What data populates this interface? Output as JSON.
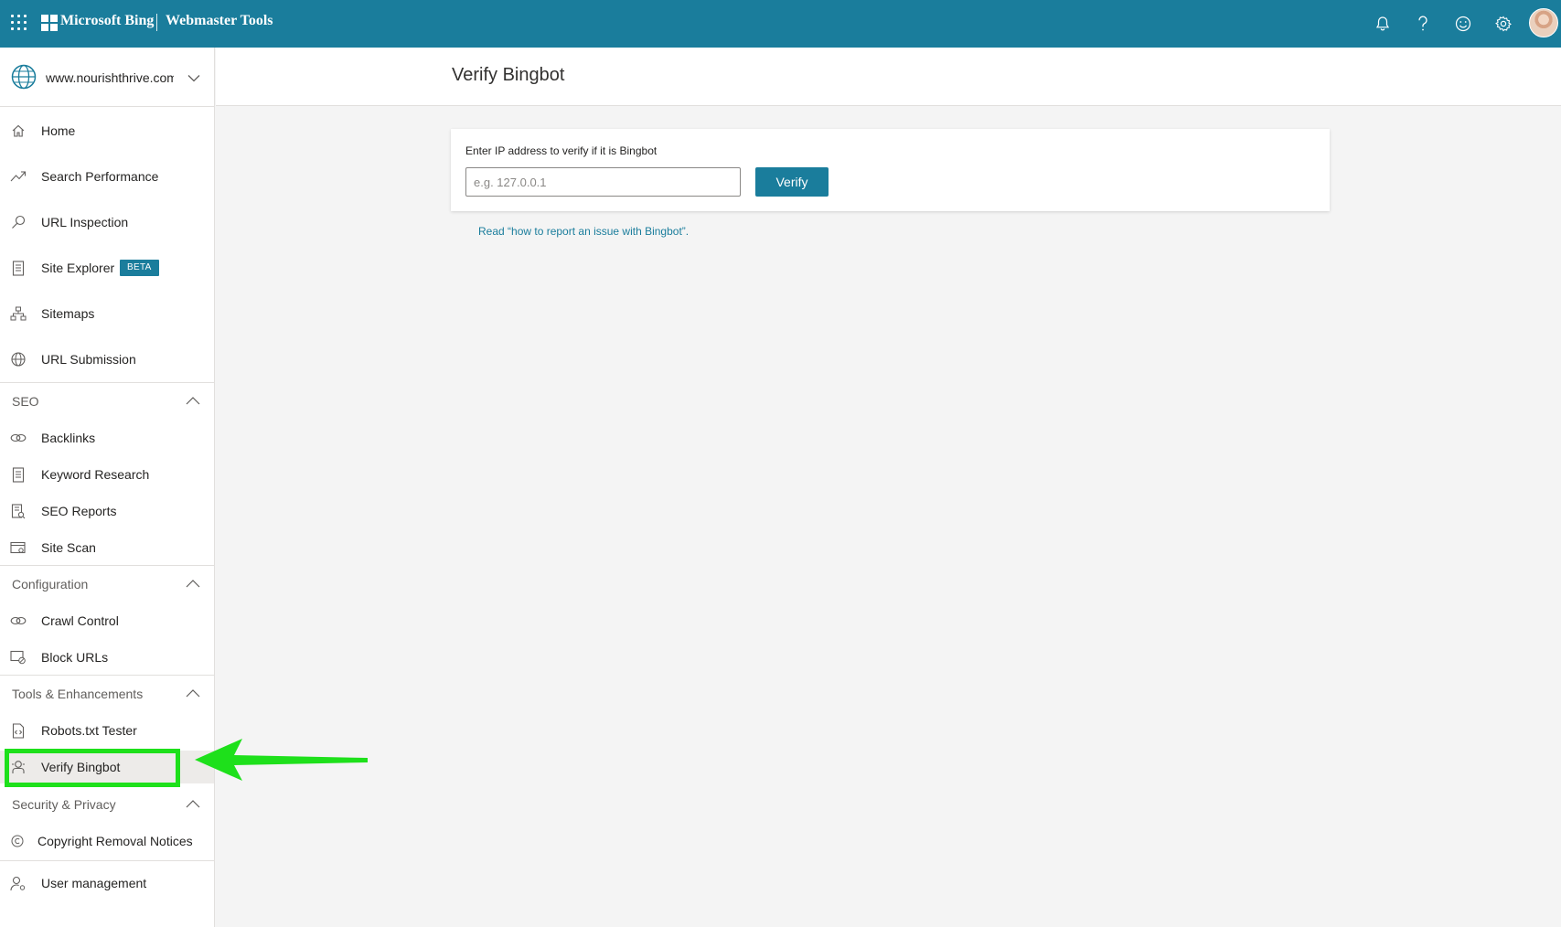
{
  "topbar": {
    "brand": "Microsoft Bing",
    "product": "Webmaster Tools",
    "icons": [
      "waffle-icon",
      "bell-icon",
      "help-icon",
      "feedback-smiley-icon",
      "gear-icon",
      "avatar"
    ],
    "bg_color": "#1a7d9c"
  },
  "sidebar": {
    "site": {
      "url": "www.nourishthrive.com",
      "icon": "globe-icon"
    },
    "items": [
      {
        "label": "Home",
        "icon": "home-icon"
      },
      {
        "label": "Search Performance",
        "icon": "trend-icon"
      },
      {
        "label": "URL Inspection",
        "icon": "search-icon"
      },
      {
        "label": "Site Explorer",
        "icon": "document-icon",
        "badge": "BETA"
      },
      {
        "label": "Sitemaps",
        "icon": "sitemap-icon"
      },
      {
        "label": "URL Submission",
        "icon": "globe-icon"
      }
    ],
    "sections": [
      {
        "title": "SEO",
        "items": [
          {
            "label": "Backlinks",
            "icon": "link-icon"
          },
          {
            "label": "Keyword Research",
            "icon": "document-icon"
          },
          {
            "label": "SEO Reports",
            "icon": "report-icon"
          },
          {
            "label": "Site Scan",
            "icon": "scan-icon"
          }
        ]
      },
      {
        "title": "Configuration",
        "items": [
          {
            "label": "Crawl Control",
            "icon": "link-icon"
          },
          {
            "label": "Block URLs",
            "icon": "block-icon"
          }
        ]
      },
      {
        "title": "Tools & Enhancements",
        "items": [
          {
            "label": "Robots.txt Tester",
            "icon": "code-file-icon"
          },
          {
            "label": "Verify Bingbot",
            "icon": "robot-icon",
            "active": true
          }
        ]
      },
      {
        "title": "Security & Privacy",
        "items": [
          {
            "label": "Copyright Removal Notices",
            "icon": "copyright-icon"
          }
        ]
      }
    ],
    "footer_item": {
      "label": "User management",
      "icon": "user-settings-icon"
    }
  },
  "main": {
    "title": "Verify Bingbot",
    "card": {
      "label": "Enter IP address to verify if it is Bingbot",
      "input_placeholder": "e.g. 127.0.0.1",
      "input_value": "",
      "button_label": "Verify"
    },
    "help_link": "Read “how to report an issue with Bingbot”."
  },
  "annotation": {
    "highlight_color": "#1ee01b",
    "target": "Verify Bingbot"
  }
}
